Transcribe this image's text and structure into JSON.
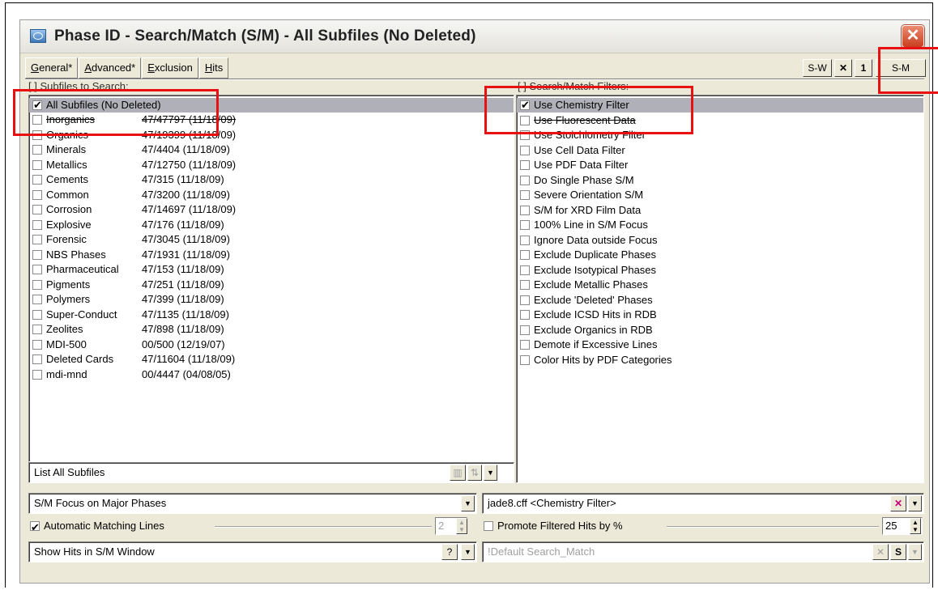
{
  "window": {
    "title": "Phase ID - Search/Match (S/M) - All Subfiles (No Deleted)"
  },
  "tabs": [
    {
      "label": "General*",
      "mnemonic": "G",
      "rest": "eneral*"
    },
    {
      "label": "Advanced*",
      "mnemonic": "A",
      "rest": "dvanced*"
    },
    {
      "label": "Exclusion",
      "mnemonic": "E",
      "rest": "xclusion"
    },
    {
      "label": "Hits",
      "mnemonic": "H",
      "rest": "its"
    }
  ],
  "toolbar": {
    "sw_label": "S-W",
    "x_label": "✕",
    "one_label": "1",
    "sm_label": "S-M"
  },
  "subfiles": {
    "header": "[ ] Subfiles to Search:",
    "all_label": "All Subfiles (No Deleted)",
    "items": [
      {
        "name": "Inorganics",
        "info": "47/47797 (11/18/09)"
      },
      {
        "name": "Organics",
        "info": "47/19399 (11/18/09)"
      },
      {
        "name": "Minerals",
        "info": "47/4404 (11/18/09)"
      },
      {
        "name": "Metallics",
        "info": "47/12750 (11/18/09)"
      },
      {
        "name": "Cements",
        "info": "47/315 (11/18/09)"
      },
      {
        "name": "Common",
        "info": "47/3200 (11/18/09)"
      },
      {
        "name": "Corrosion",
        "info": "47/14697 (11/18/09)"
      },
      {
        "name": "Explosive",
        "info": "47/176 (11/18/09)"
      },
      {
        "name": "Forensic",
        "info": "47/3045 (11/18/09)"
      },
      {
        "name": "NBS Phases",
        "info": "47/1931 (11/18/09)"
      },
      {
        "name": "Pharmaceutical",
        "info": "47/153 (11/18/09)"
      },
      {
        "name": "Pigments",
        "info": "47/251 (11/18/09)"
      },
      {
        "name": "Polymers",
        "info": "47/399 (11/18/09)"
      },
      {
        "name": "Super-Conduct",
        "info": "47/1135 (11/18/09)"
      },
      {
        "name": "Zeolites",
        "info": "47/898 (11/18/09)"
      },
      {
        "name": "MDI-500",
        "info": "00/500 (12/19/07)"
      },
      {
        "name": "Deleted Cards",
        "info": "47/11604 (11/18/09)"
      },
      {
        "name": "mdi-mnd",
        "info": "00/4447 (04/08/05)"
      }
    ],
    "list_mode": "List All Subfiles"
  },
  "filters": {
    "header": "[ ] Search/Match Filters:",
    "items": [
      {
        "label": "Use Chemistry Filter",
        "checked": true
      },
      {
        "label": "Use Fluorescent Data",
        "checked": false
      },
      {
        "label": "Use Stoichiometry Filter",
        "checked": false
      },
      {
        "label": "Use Cell Data Filter",
        "checked": false
      },
      {
        "label": "Use PDF Data Filter",
        "checked": false
      },
      {
        "label": "Do Single Phase S/M",
        "checked": false
      },
      {
        "label": "Severe Orientation S/M",
        "checked": false
      },
      {
        "label": "S/M for XRD Film Data",
        "checked": false
      },
      {
        "label": "100% Line in S/M Focus",
        "checked": false
      },
      {
        "label": "Ignore Data outside Focus",
        "checked": false
      },
      {
        "label": "Exclude Duplicate Phases",
        "checked": false
      },
      {
        "label": "Exclude Isotypical Phases",
        "checked": false
      },
      {
        "label": "Exclude Metallic Phases",
        "checked": false
      },
      {
        "label": "Exclude 'Deleted' Phases",
        "checked": false
      },
      {
        "label": "Exclude ICSD Hits in RDB",
        "checked": false
      },
      {
        "label": "Exclude Organics in RDB",
        "checked": false
      },
      {
        "label": "Demote if Excessive Lines",
        "checked": false
      },
      {
        "label": "Color Hits by PDF Categories",
        "checked": false
      }
    ]
  },
  "bottom": {
    "focus_value": "S/M Focus on Major Phases",
    "filter_file": "jade8.cff <Chemistry Filter>",
    "auto_lines_label": "Automatic Matching Lines",
    "auto_lines_value": "2",
    "promote_label": "Promote Filtered Hits by %",
    "promote_value": "25",
    "show_hits_value": "Show Hits in S/M Window",
    "help_label": "?",
    "default_value": "!Default Search_Match",
    "x_label": "✕",
    "s_label": "S"
  }
}
